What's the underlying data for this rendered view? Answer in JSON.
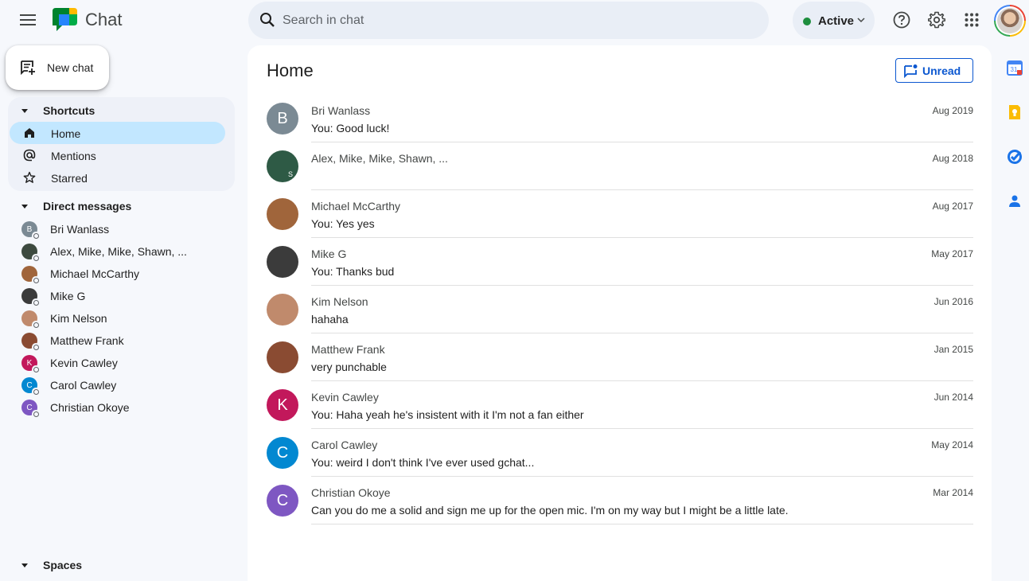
{
  "app": {
    "title": "Chat"
  },
  "search": {
    "placeholder": "Search in chat"
  },
  "status": {
    "label": "Active",
    "color": "#1e8e3e"
  },
  "new_chat": {
    "label": "New chat"
  },
  "sidebar": {
    "shortcuts_label": "Shortcuts",
    "shortcuts": [
      {
        "label": "Home",
        "icon": "home-icon",
        "active": true
      },
      {
        "label": "Mentions",
        "icon": "at-icon"
      },
      {
        "label": "Starred",
        "icon": "star-icon"
      }
    ],
    "dm_label": "Direct messages",
    "dms": [
      {
        "label": "Bri Wanlass",
        "initial": "B",
        "color": "#7b8a94"
      },
      {
        "label": "Alex, Mike, Mike, Shawn, ...",
        "initial": "",
        "color": "#3d4a3f"
      },
      {
        "label": "Michael McCarthy",
        "initial": "",
        "color": "#a0653b"
      },
      {
        "label": "Mike G",
        "initial": "",
        "color": "#3b3b3b"
      },
      {
        "label": "Kim Nelson",
        "initial": "",
        "color": "#c08a6c"
      },
      {
        "label": "Matthew Frank",
        "initial": "",
        "color": "#8a4b32"
      },
      {
        "label": "Kevin Cawley",
        "initial": "K",
        "color": "#c2185b"
      },
      {
        "label": "Carol Cawley",
        "initial": "C",
        "color": "#0288d1"
      },
      {
        "label": "Christian Okoye",
        "initial": "C",
        "color": "#7e57c2"
      }
    ],
    "spaces_label": "Spaces"
  },
  "main": {
    "title": "Home",
    "unread_label": "Unread",
    "conversations": [
      {
        "name": "Bri Wanlass",
        "snippet": "You: Good luck!",
        "date": "Aug 2019",
        "initial": "B",
        "color": "#7b8a94"
      },
      {
        "name": "Alex, Mike, Mike, Shawn, ...",
        "snippet": "",
        "date": "Aug 2018",
        "initial": "S",
        "color": "#2e5a45"
      },
      {
        "name": "Michael McCarthy",
        "snippet": "You: Yes yes",
        "date": "Aug 2017",
        "initial": "",
        "color": "#a0653b"
      },
      {
        "name": "Mike G",
        "snippet": "You: Thanks bud",
        "date": "May 2017",
        "initial": "",
        "color": "#3b3b3b"
      },
      {
        "name": "Kim Nelson",
        "snippet": "hahaha",
        "date": "Jun 2016",
        "initial": "",
        "color": "#c08a6c"
      },
      {
        "name": "Matthew Frank",
        "snippet": "very punchable",
        "date": "Jan 2015",
        "initial": "",
        "color": "#8a4b32"
      },
      {
        "name": "Kevin Cawley",
        "snippet": "You: Haha yeah he's insistent with it I'm not a fan either",
        "date": "Jun 2014",
        "initial": "K",
        "color": "#c2185b"
      },
      {
        "name": "Carol Cawley",
        "snippet": "You: weird I don't think I've ever used gchat...",
        "date": "May 2014",
        "initial": "C",
        "color": "#0288d1"
      },
      {
        "name": "Christian Okoye",
        "snippet": "Can you do me a solid and sign me up for the open mic. I'm on my way but I might be a little late.",
        "date": "Mar 2014",
        "initial": "C",
        "color": "#7e57c2"
      }
    ]
  },
  "right_rail": {
    "items": [
      {
        "icon": "calendar-icon",
        "label": "31"
      },
      {
        "icon": "keep-icon"
      },
      {
        "icon": "tasks-icon"
      },
      {
        "icon": "contacts-icon"
      }
    ]
  },
  "colors": {
    "accent": "#0b57d0",
    "selected": "#c2e7ff",
    "background": "#f6f8fc"
  }
}
